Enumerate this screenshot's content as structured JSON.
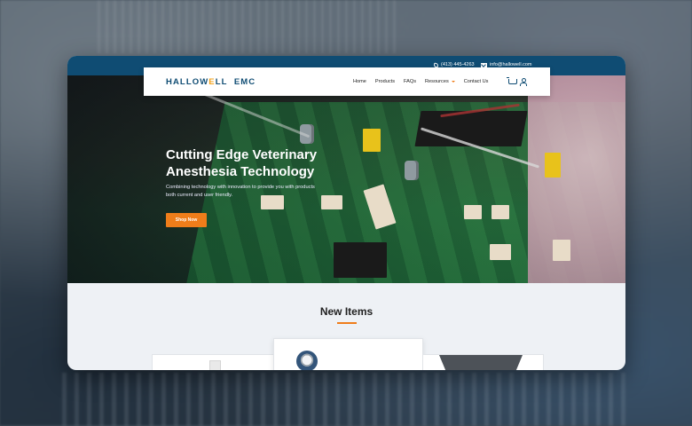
{
  "topbar": {
    "phone": "(413) 445-4263",
    "email": "info@hallowell.com",
    "color": "#0f4c73"
  },
  "logo": {
    "part1": "HALLOW",
    "accent": "E",
    "part2": "LL  EMC"
  },
  "nav": {
    "items": [
      "Home",
      "Products",
      "FAQs",
      "Resources",
      "Contact Us"
    ],
    "cart_icon": "cart-icon",
    "user_icon": "user-icon"
  },
  "hero": {
    "title_line1": "Cutting Edge Veterinary",
    "title_line2": "Anesthesia Technology",
    "subtitle_line1": "Combining technology with innovation to provide you with products",
    "subtitle_line2": "both current and user friendly.",
    "cta": "Shop Now",
    "cta_color": "#ef7d1a"
  },
  "new_items": {
    "title": "New Items"
  }
}
